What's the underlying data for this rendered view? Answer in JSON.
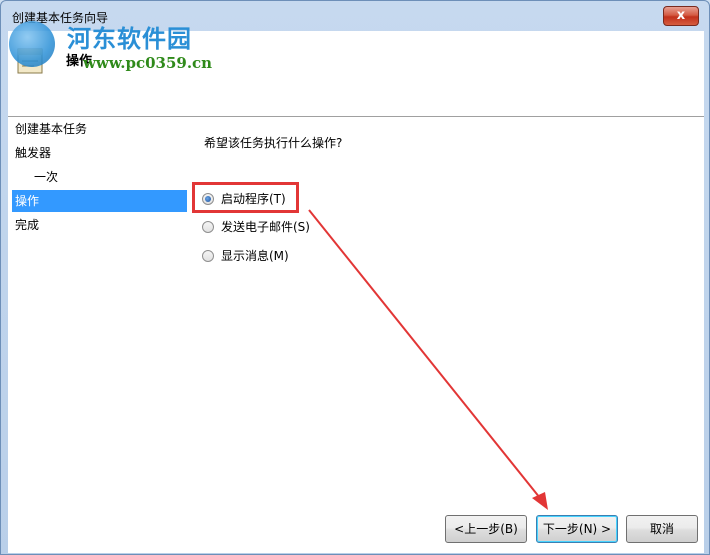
{
  "window": {
    "title": "创建基本任务向导",
    "close_label": "x"
  },
  "header": {
    "title": "操作",
    "icon": "task-wizard-icon"
  },
  "watermark": {
    "site_name": "河东软件园",
    "url": "www.pc0359.cn"
  },
  "sidebar": {
    "items": [
      {
        "label": "创建基本任务"
      },
      {
        "label": "触发器"
      },
      {
        "label": "一次"
      },
      {
        "label": "操作"
      },
      {
        "label": "完成"
      }
    ],
    "active_index": 3
  },
  "content": {
    "question": "希望该任务执行什么操作?",
    "options": [
      {
        "label": "启动程序(T)",
        "checked": true
      },
      {
        "label": "发送电子邮件(S)",
        "checked": false
      },
      {
        "label": "显示消息(M)",
        "checked": false
      }
    ]
  },
  "footer": {
    "back_label": "<上一步(B)",
    "next_label": "下一步(N) >",
    "cancel_label": "取消"
  },
  "colors": {
    "selection": "#3399ff",
    "annotation_red": "#e23636",
    "title_bar": "#c6d9ef"
  }
}
